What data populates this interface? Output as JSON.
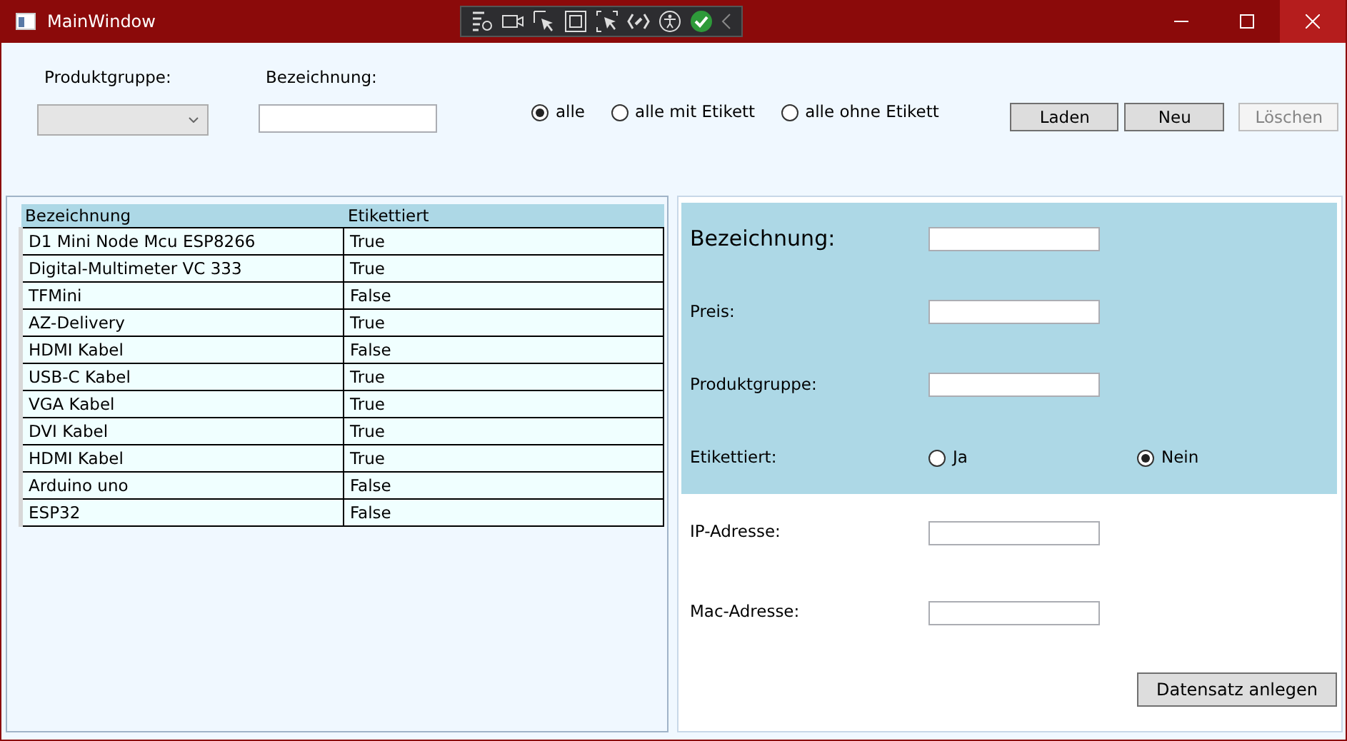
{
  "window": {
    "title": "MainWindow"
  },
  "filter": {
    "group_label": "Produktgruppe:",
    "name_label": "Bezeichnung:",
    "options": [
      {
        "label": "alle",
        "selected": true
      },
      {
        "label": "alle mit Etikett",
        "selected": false
      },
      {
        "label": "alle ohne Etikett",
        "selected": false
      }
    ],
    "buttons": [
      {
        "label": "Laden",
        "disabled": false
      },
      {
        "label": "Neu",
        "disabled": false
      },
      {
        "label": "Löschen",
        "disabled": true
      }
    ]
  },
  "table": {
    "columns": [
      "Bezeichnung",
      "Etikettiert"
    ],
    "rows": [
      [
        "D1 Mini Node Mcu ESP8266",
        "True"
      ],
      [
        "Digital-Multimeter VC 333",
        "True"
      ],
      [
        "TFMini",
        "False"
      ],
      [
        "AZ-Delivery",
        "True"
      ],
      [
        "HDMI Kabel",
        "False"
      ],
      [
        "USB-C Kabel",
        "True"
      ],
      [
        "VGA Kabel",
        "True"
      ],
      [
        "DVI Kabel",
        "True"
      ],
      [
        "HDMI Kabel",
        "True"
      ],
      [
        "Arduino uno",
        "False"
      ],
      [
        "ESP32",
        "False"
      ]
    ]
  },
  "form": {
    "primary": [
      {
        "kind": "heading-field",
        "label": "Bezeichnung:"
      },
      {
        "kind": "field",
        "label": "Preis:"
      },
      {
        "kind": "field",
        "label": "Produktgruppe:"
      },
      {
        "kind": "radio",
        "label": "Etikettiert:",
        "options": [
          {
            "label": "Ja",
            "selected": false
          },
          {
            "label": "Nein",
            "selected": true
          }
        ]
      }
    ],
    "secondary": [
      {
        "kind": "field",
        "label": "IP-Adresse:"
      },
      {
        "kind": "field",
        "label": "Mac-Adresse:"
      }
    ],
    "submit": "Datensatz anlegen"
  }
}
